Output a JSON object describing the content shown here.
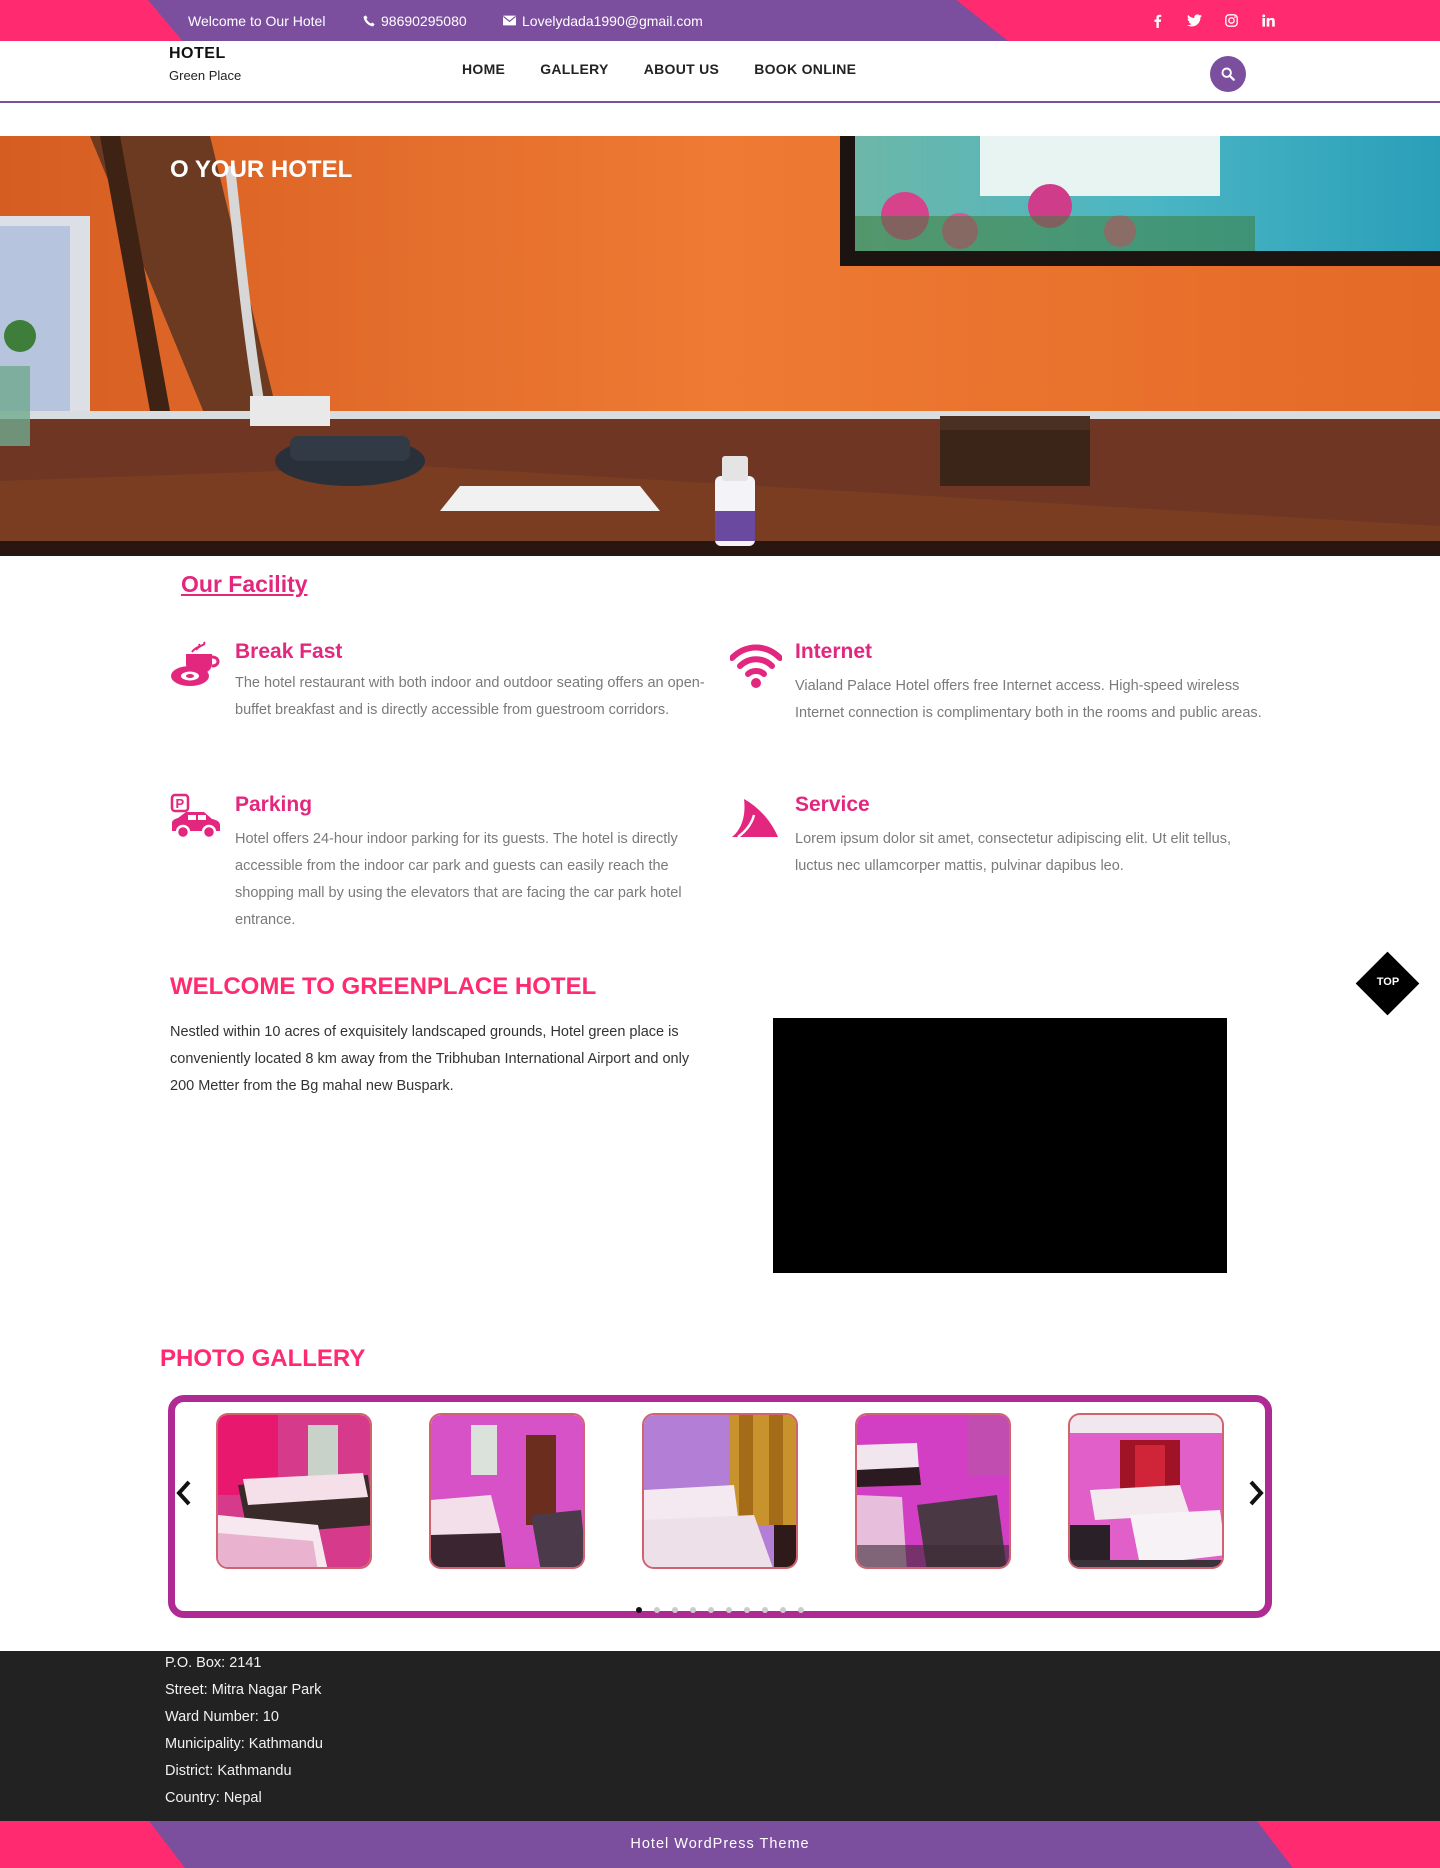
{
  "topbar": {
    "welcome": "Welcome to Our Hotel",
    "phone": "98690295080",
    "email": "Lovelydada1990@gmail.com",
    "social_icons": [
      "facebook-icon",
      "twitter-icon",
      "instagram-icon",
      "linkedin-icon"
    ]
  },
  "header": {
    "logo_title": "HOTEL",
    "logo_subtitle": "Green Place",
    "nav": [
      "HOME",
      "GALLERY",
      "ABOUT US",
      "BOOK ONLINE"
    ]
  },
  "hero": {
    "title": "O YOUR HOTEL"
  },
  "facility": {
    "title": "Our Facility",
    "items": [
      {
        "title": "Break Fast",
        "text": "The hotel restaurant with both indoor and outdoor seating offers an open-buffet breakfast and is directly accessible from guestroom corridors.",
        "icon": "coffee-icon"
      },
      {
        "title": "Internet",
        "text": "Vialand Palace Hotel offers free Internet access. High-speed wireless Internet connection is complimentary both in the rooms and public areas.",
        "icon": "wifi-icon"
      },
      {
        "title": "Parking",
        "text": "Hotel offers 24-hour indoor parking for its guests. The hotel is directly accessible from the indoor car park and guests can easily reach the shopping mall by using the elevators that are facing the car park hotel entrance.",
        "icon": "parking-car-icon"
      },
      {
        "title": "Service",
        "text": "Lorem ipsum dolor sit amet, consectetur adipiscing elit. Ut elit tellus, luctus nec ullamcorper mattis, pulvinar dapibus leo.",
        "icon": "service-icon"
      }
    ]
  },
  "welcome": {
    "title": "WELCOME TO GREENPLACE HOTEL",
    "text": "Nestled within 10 acres of exquisitely landscaped grounds, Hotel green place  is conveniently located 8 km away from the Tribhuban International Airport and only 200 Metter  from the Bg mahal new Buspark."
  },
  "top_button": {
    "label": "TOP"
  },
  "gallery": {
    "title": "PHOTO GALLERY",
    "photos": [
      "room-photo-1",
      "room-photo-2",
      "room-photo-3",
      "room-photo-4",
      "room-photo-5"
    ],
    "dot_count": 10,
    "active_dot": 1
  },
  "footer": {
    "lines": [
      "P.O. Box: 2141",
      "Street: Mitra Nagar Park",
      "Ward Number: 10",
      "Municipality: Kathmandu",
      "District: Kathmandu",
      "Country: Nepal"
    ],
    "credit": "Hotel WordPress Theme"
  },
  "colors": {
    "brand_pink": "#ff2a6f",
    "brand_purple": "#7b4f9e",
    "facility_pink": "#e3277e",
    "gallery_frame": "#b02a94"
  }
}
